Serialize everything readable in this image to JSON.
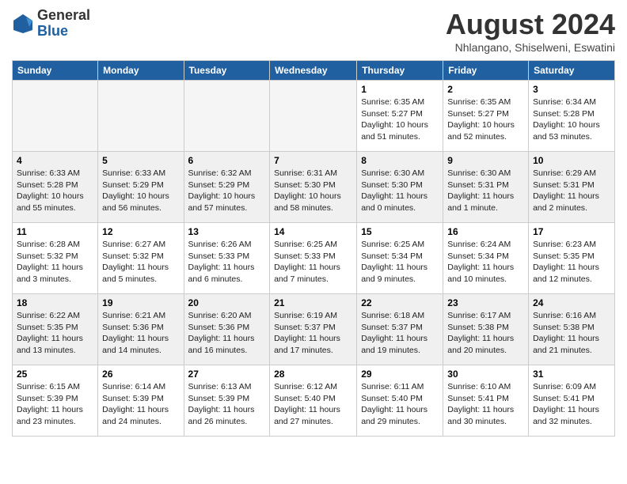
{
  "logo": {
    "general": "General",
    "blue": "Blue"
  },
  "title": {
    "month_year": "August 2024",
    "location": "Nhlangano, Shiselweni, Eswatini"
  },
  "days_of_week": [
    "Sunday",
    "Monday",
    "Tuesday",
    "Wednesday",
    "Thursday",
    "Friday",
    "Saturday"
  ],
  "weeks": [
    {
      "shaded": false,
      "days": [
        {
          "num": "",
          "info": ""
        },
        {
          "num": "",
          "info": ""
        },
        {
          "num": "",
          "info": ""
        },
        {
          "num": "",
          "info": ""
        },
        {
          "num": "1",
          "info": "Sunrise: 6:35 AM\nSunset: 5:27 PM\nDaylight: 10 hours\nand 51 minutes."
        },
        {
          "num": "2",
          "info": "Sunrise: 6:35 AM\nSunset: 5:27 PM\nDaylight: 10 hours\nand 52 minutes."
        },
        {
          "num": "3",
          "info": "Sunrise: 6:34 AM\nSunset: 5:28 PM\nDaylight: 10 hours\nand 53 minutes."
        }
      ]
    },
    {
      "shaded": true,
      "days": [
        {
          "num": "4",
          "info": "Sunrise: 6:33 AM\nSunset: 5:28 PM\nDaylight: 10 hours\nand 55 minutes."
        },
        {
          "num": "5",
          "info": "Sunrise: 6:33 AM\nSunset: 5:29 PM\nDaylight: 10 hours\nand 56 minutes."
        },
        {
          "num": "6",
          "info": "Sunrise: 6:32 AM\nSunset: 5:29 PM\nDaylight: 10 hours\nand 57 minutes."
        },
        {
          "num": "7",
          "info": "Sunrise: 6:31 AM\nSunset: 5:30 PM\nDaylight: 10 hours\nand 58 minutes."
        },
        {
          "num": "8",
          "info": "Sunrise: 6:30 AM\nSunset: 5:30 PM\nDaylight: 11 hours\nand 0 minutes."
        },
        {
          "num": "9",
          "info": "Sunrise: 6:30 AM\nSunset: 5:31 PM\nDaylight: 11 hours\nand 1 minute."
        },
        {
          "num": "10",
          "info": "Sunrise: 6:29 AM\nSunset: 5:31 PM\nDaylight: 11 hours\nand 2 minutes."
        }
      ]
    },
    {
      "shaded": false,
      "days": [
        {
          "num": "11",
          "info": "Sunrise: 6:28 AM\nSunset: 5:32 PM\nDaylight: 11 hours\nand 3 minutes."
        },
        {
          "num": "12",
          "info": "Sunrise: 6:27 AM\nSunset: 5:32 PM\nDaylight: 11 hours\nand 5 minutes."
        },
        {
          "num": "13",
          "info": "Sunrise: 6:26 AM\nSunset: 5:33 PM\nDaylight: 11 hours\nand 6 minutes."
        },
        {
          "num": "14",
          "info": "Sunrise: 6:25 AM\nSunset: 5:33 PM\nDaylight: 11 hours\nand 7 minutes."
        },
        {
          "num": "15",
          "info": "Sunrise: 6:25 AM\nSunset: 5:34 PM\nDaylight: 11 hours\nand 9 minutes."
        },
        {
          "num": "16",
          "info": "Sunrise: 6:24 AM\nSunset: 5:34 PM\nDaylight: 11 hours\nand 10 minutes."
        },
        {
          "num": "17",
          "info": "Sunrise: 6:23 AM\nSunset: 5:35 PM\nDaylight: 11 hours\nand 12 minutes."
        }
      ]
    },
    {
      "shaded": true,
      "days": [
        {
          "num": "18",
          "info": "Sunrise: 6:22 AM\nSunset: 5:35 PM\nDaylight: 11 hours\nand 13 minutes."
        },
        {
          "num": "19",
          "info": "Sunrise: 6:21 AM\nSunset: 5:36 PM\nDaylight: 11 hours\nand 14 minutes."
        },
        {
          "num": "20",
          "info": "Sunrise: 6:20 AM\nSunset: 5:36 PM\nDaylight: 11 hours\nand 16 minutes."
        },
        {
          "num": "21",
          "info": "Sunrise: 6:19 AM\nSunset: 5:37 PM\nDaylight: 11 hours\nand 17 minutes."
        },
        {
          "num": "22",
          "info": "Sunrise: 6:18 AM\nSunset: 5:37 PM\nDaylight: 11 hours\nand 19 minutes."
        },
        {
          "num": "23",
          "info": "Sunrise: 6:17 AM\nSunset: 5:38 PM\nDaylight: 11 hours\nand 20 minutes."
        },
        {
          "num": "24",
          "info": "Sunrise: 6:16 AM\nSunset: 5:38 PM\nDaylight: 11 hours\nand 21 minutes."
        }
      ]
    },
    {
      "shaded": false,
      "days": [
        {
          "num": "25",
          "info": "Sunrise: 6:15 AM\nSunset: 5:39 PM\nDaylight: 11 hours\nand 23 minutes."
        },
        {
          "num": "26",
          "info": "Sunrise: 6:14 AM\nSunset: 5:39 PM\nDaylight: 11 hours\nand 24 minutes."
        },
        {
          "num": "27",
          "info": "Sunrise: 6:13 AM\nSunset: 5:39 PM\nDaylight: 11 hours\nand 26 minutes."
        },
        {
          "num": "28",
          "info": "Sunrise: 6:12 AM\nSunset: 5:40 PM\nDaylight: 11 hours\nand 27 minutes."
        },
        {
          "num": "29",
          "info": "Sunrise: 6:11 AM\nSunset: 5:40 PM\nDaylight: 11 hours\nand 29 minutes."
        },
        {
          "num": "30",
          "info": "Sunrise: 6:10 AM\nSunset: 5:41 PM\nDaylight: 11 hours\nand 30 minutes."
        },
        {
          "num": "31",
          "info": "Sunrise: 6:09 AM\nSunset: 5:41 PM\nDaylight: 11 hours\nand 32 minutes."
        }
      ]
    }
  ]
}
